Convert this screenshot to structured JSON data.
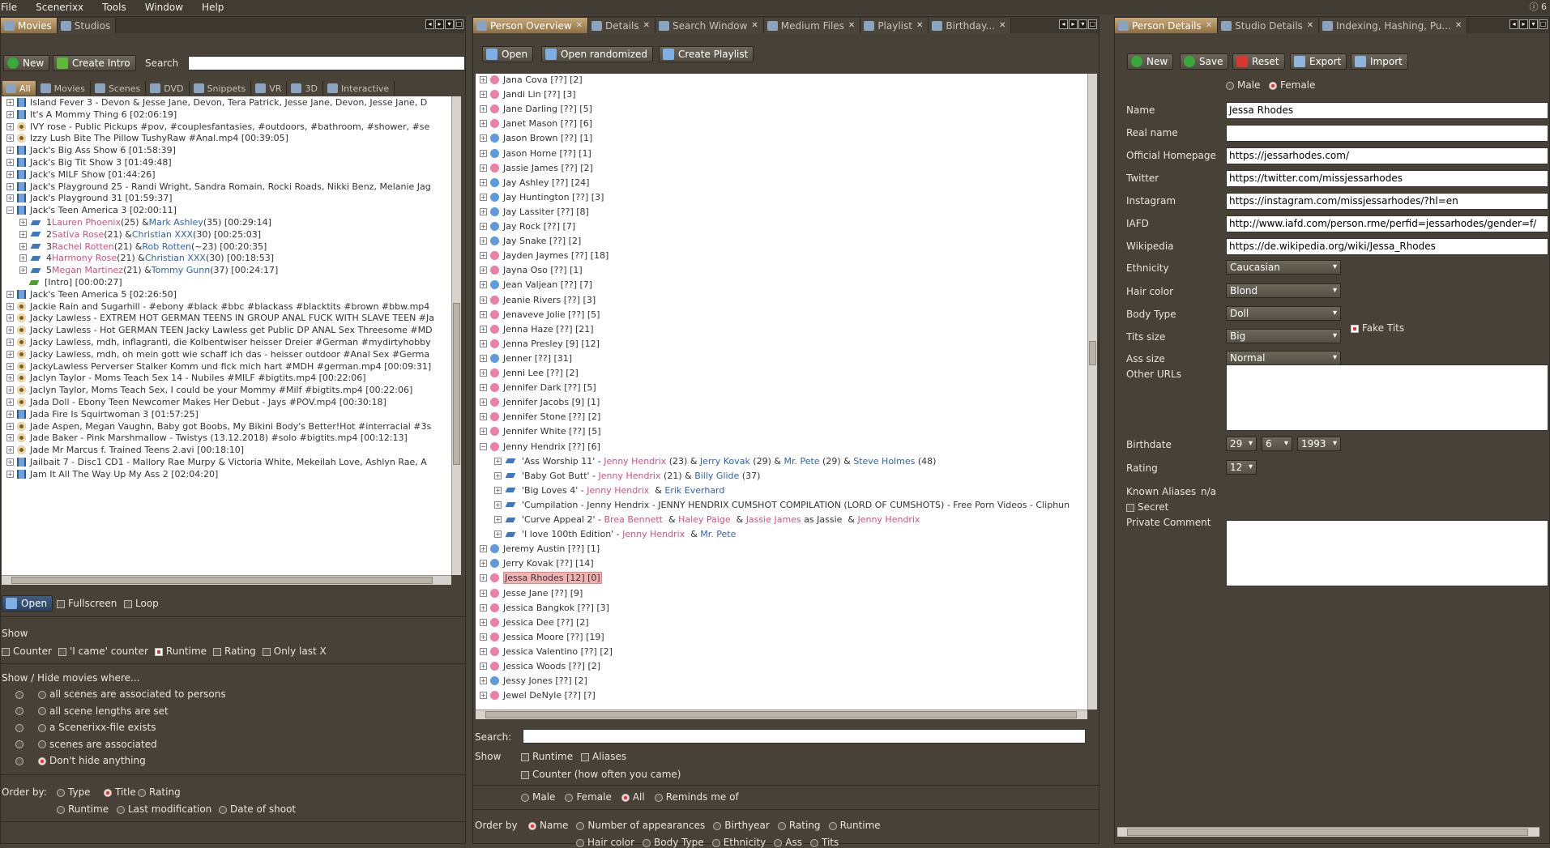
{
  "menu": {
    "items": [
      "File",
      "Scenerixx",
      "Tools",
      "Window",
      "Help"
    ],
    "right": "6"
  },
  "left": {
    "tabs": [
      "Movies",
      "Studios"
    ],
    "buttons": {
      "new": "New",
      "create_intro": "Create Intro"
    },
    "search_label": "Search",
    "filter_tabs": [
      "All",
      "Movies",
      "Scenes",
      "DVD",
      "Snippets",
      "VR",
      "3D",
      "Interactive"
    ],
    "movies": [
      {
        "t": "Island Fever 3 - Devon & Jesse Jane, Devon, Tera Patrick, Jesse Jane, Devon, Jesse Jane, D",
        "i": "film"
      },
      {
        "t": "It's A Mommy Thing 6 [02:06:19]",
        "i": "film"
      },
      {
        "t": "IVY rose - Public Pickups #pov, #couplesfantasies, #outdoors, #bathroom, #shower, #se",
        "i": "eye"
      },
      {
        "t": "Izzy Lush Bite The Pillow TushyRaw #Anal.mp4 [00:39:05]",
        "i": "eye"
      },
      {
        "t": "Jack's Big Ass Show 6 [01:58:39]",
        "i": "film"
      },
      {
        "t": "Jack's Big Tit Show 3 [01:49:48]",
        "i": "film"
      },
      {
        "t": "Jack's MILF Show [01:44:26]",
        "i": "film"
      },
      {
        "t": "Jack's Playground 25 - Randi Wright, Sandra Romain, Rocki Roads, Nikki Benz, Melanie Jag",
        "i": "film"
      },
      {
        "t": "Jack's Playground 31 [01:59:37]",
        "i": "film"
      },
      {
        "t": "Jack's Teen America 3 [02:00:11]",
        "i": "film",
        "open": true
      }
    ],
    "scenes": [
      {
        "n": "1",
        "p1": "Lauren Phoenix",
        "a1": "(25) &",
        "p2": "Mark Ashley",
        "a2": "(35) [00:29:14]"
      },
      {
        "n": "2",
        "p1": "Sativa Rose",
        "a1": "(21) &",
        "p2": "Christian XXX",
        "a2": "(30) [00:25:03]"
      },
      {
        "n": "3",
        "p1": "Rachel Rotten",
        "a1": "(21) &",
        "p2": "Rob Rotten",
        "a2": "(~23) [00:20:35]"
      },
      {
        "n": "4",
        "p1": "Harmony Rose",
        "a1": "(21) &",
        "p2": "Christian XXX",
        "a2": "(30) [00:18:53]"
      },
      {
        "n": "5",
        "p1": "Megan Martinez",
        "a1": "(21) &",
        "p2": "Tommy Gunn",
        "a2": "(37) [00:24:17]"
      }
    ],
    "intro": "[Intro]  [00:00:27]",
    "movies2": [
      {
        "t": "Jack's Teen America 5 [02:26:50]",
        "i": "film"
      },
      {
        "t": "Jackie Rain and Sugarhill - #ebony #black #bbc #blackass #blacktits #brown #bbw.mp4",
        "i": "eye"
      },
      {
        "t": "Jacky Lawless - EXTREM HOT GERMAN TEENS IN GROUP ANAL FUCK WITH SLAVE TEEN #Ja",
        "i": "eye"
      },
      {
        "t": "Jacky Lawless - Hot GERMAN TEEN Jacky Lawless get Public DP ANAL Sex Threesome #MD",
        "i": "eye"
      },
      {
        "t": "Jacky Lawless, mdh, inflagranti, die Kolbentwiser heisser Dreier #German #mydirtyhobby",
        "i": "eye"
      },
      {
        "t": "Jacky Lawless, mdh, oh mein gott wie schaff ich das - heisser outdoor #Anal Sex #Germa",
        "i": "eye"
      },
      {
        "t": "JackyLawless Perverser Stalker Komm und fick mich hart #MDH #german.mp4 [00:09:31]",
        "i": "eye"
      },
      {
        "t": "Jaclyn Taylor - Moms Teach Sex 14 - Nubiles #MILF #bigtits.mp4 [00:22:06]",
        "i": "eye"
      },
      {
        "t": "Jaclyn Taylor, Moms Teach Sex, I could be your Mommy #Milf #bigtits.mp4 [00:22:06]",
        "i": "eye"
      },
      {
        "t": "Jada Doll - Ebony Teen Newcomer Makes Her Debut - Jays #POV.mp4 [00:30:18]",
        "i": "eye"
      },
      {
        "t": "Jada Fire Is Squirtwoman 3 [01:57:25]",
        "i": "film"
      },
      {
        "t": "Jade Aspen, Megan Vaughn, Baby got Boobs, My Bikini Body's Better!Hot #interracial #3s",
        "i": "eye"
      },
      {
        "t": "Jade Baker - Pink Marshmallow - Twistys (13.12.2018) #solo #bigtits.mp4 [00:12:13]",
        "i": "eye"
      },
      {
        "t": "Jade Mr Marcus f. Trained Teens 2.avi [00:18:10]",
        "i": "eye"
      },
      {
        "t": "Jailbait 7 - Disc1 CD1 - Mallory Rae Murpy & Victoria White, Mekeilah Love, Ashlyn Rae, A",
        "i": "film"
      },
      {
        "t": "Jam It All The Way Up My Ass 2 [02:04:20]",
        "i": "film"
      }
    ],
    "open_btn": "Open",
    "fullscreen": "Fullscreen",
    "loop": "Loop",
    "show_label": "Show",
    "show_opts": [
      {
        "l": "Counter",
        "on": false
      },
      {
        "l": "'I came' counter",
        "on": false
      },
      {
        "l": "Runtime",
        "on": true
      },
      {
        "l": "Rating",
        "on": false
      },
      {
        "l": "Only last X",
        "on": false
      }
    ],
    "hide_label": "Show    / Hide movies where...",
    "hide_opts": [
      {
        "l": "all scenes are associated to persons",
        "on": false
      },
      {
        "l": "all scene lengths are set",
        "on": false
      },
      {
        "l": "a Scenerixx-file exists",
        "on": false
      },
      {
        "l": "scenes are associated",
        "on": false
      },
      {
        "l": "Don't hide anything",
        "on": true
      }
    ],
    "order_label": "Order by:",
    "order_opts": [
      {
        "l": "Type",
        "on": false
      },
      {
        "l": "Title",
        "on": true
      },
      {
        "l": "Rating",
        "on": false
      },
      {
        "l": "Runtime",
        "on": false
      },
      {
        "l": "Last modification",
        "on": false
      },
      {
        "l": "Date of shoot",
        "on": false
      }
    ]
  },
  "mid": {
    "tabs": [
      "Person Overview",
      "Details",
      "Search Window",
      "Medium Files",
      "Playlist",
      "Birthday..."
    ],
    "buttons": {
      "open": "Open",
      "open_rand": "Open randomized",
      "create_playlist": "Create Playlist"
    },
    "persons_a": [
      {
        "n": "Jana Cova [??] [2]",
        "g": "f"
      },
      {
        "n": "Jandi Lin [??] [3]",
        "g": "f"
      },
      {
        "n": "Jane Darling [??] [5]",
        "g": "f"
      },
      {
        "n": "Janet Mason [??] [6]",
        "g": "f"
      },
      {
        "n": "Jason Brown [??] [1]",
        "g": "m"
      },
      {
        "n": "Jason Horne [??] [1]",
        "g": "m"
      },
      {
        "n": "Jassie James [??] [2]",
        "g": "f"
      },
      {
        "n": "Jay Ashley [??] [24]",
        "g": "m"
      },
      {
        "n": "Jay Huntington [??] [3]",
        "g": "m"
      },
      {
        "n": "Jay Lassiter [??] [8]",
        "g": "m"
      },
      {
        "n": "Jay Rock [??] [7]",
        "g": "m"
      },
      {
        "n": "Jay Snake [??] [2]",
        "g": "m"
      },
      {
        "n": "Jayden Jaymes [??] [18]",
        "g": "f"
      },
      {
        "n": "Jayna Oso [??] [1]",
        "g": "f"
      },
      {
        "n": "Jean Valjean [??] [7]",
        "g": "m"
      },
      {
        "n": "Jeanie Rivers [??] [3]",
        "g": "f"
      },
      {
        "n": "Jenaveve Jolie [??] [5]",
        "g": "f"
      },
      {
        "n": "Jenna Haze [??] [21]",
        "g": "f"
      },
      {
        "n": "Jenna Presley [9] [12]",
        "g": "f"
      },
      {
        "n": "Jenner [??] [31]",
        "g": "m"
      },
      {
        "n": "Jenni Lee [??] [2]",
        "g": "f"
      },
      {
        "n": "Jennifer Dark [??] [5]",
        "g": "f"
      },
      {
        "n": "Jennifer Jacobs [9] [1]",
        "g": "f"
      },
      {
        "n": "Jennifer Stone [??] [2]",
        "g": "f"
      },
      {
        "n": "Jennifer White [??] [5]",
        "g": "f"
      },
      {
        "n": "Jenny Hendrix [??] [6]",
        "g": "f"
      }
    ],
    "jenny_scenes": [
      [
        {
          "t": "'Ass Worship 11' - ",
          "c": ""
        },
        {
          "t": "Jenny Hendrix",
          "c": "pink"
        },
        {
          "t": " (23) & ",
          "c": ""
        },
        {
          "t": "Jerry Kovak",
          "c": "blue"
        },
        {
          "t": " (29) & ",
          "c": ""
        },
        {
          "t": "Mr. Pete",
          "c": "blue"
        },
        {
          "t": " (29) & ",
          "c": ""
        },
        {
          "t": "Steve Holmes",
          "c": "blue"
        },
        {
          "t": " (48)",
          "c": ""
        }
      ],
      [
        {
          "t": "'Baby Got Butt' - ",
          "c": ""
        },
        {
          "t": "Jenny Hendrix",
          "c": "pink"
        },
        {
          "t": " (21) & ",
          "c": ""
        },
        {
          "t": "Billy Glide",
          "c": "blue"
        },
        {
          "t": " (37)",
          "c": ""
        }
      ],
      [
        {
          "t": "'Big Loves 4' - ",
          "c": ""
        },
        {
          "t": "Jenny Hendrix",
          "c": "pink"
        },
        {
          "t": "  & ",
          "c": ""
        },
        {
          "t": "Erik Everhard",
          "c": "blue"
        }
      ],
      [
        {
          "t": "'Cumpilation - Jenny Hendrix - JENNY HENDRIX CUMSHOT COMPILATION (LORD OF CUMSHOTS) - Free Porn Videos - Cliphun",
          "c": ""
        }
      ],
      [
        {
          "t": "'Curve Appeal 2' - ",
          "c": ""
        },
        {
          "t": "Brea Bennett",
          "c": "pink"
        },
        {
          "t": "  & ",
          "c": ""
        },
        {
          "t": "Haley Paige",
          "c": "pink"
        },
        {
          "t": "  & ",
          "c": ""
        },
        {
          "t": "Jassie James",
          "c": "pink"
        },
        {
          "t": " as Jassie  & ",
          "c": ""
        },
        {
          "t": "Jenny Hendrix",
          "c": "pink"
        }
      ],
      [
        {
          "t": "'I love 100th Edition' - ",
          "c": ""
        },
        {
          "t": "Jenny Hendrix",
          "c": "pink"
        },
        {
          "t": "  & ",
          "c": ""
        },
        {
          "t": "Mr. Pete",
          "c": "blue"
        }
      ]
    ],
    "persons_b": [
      {
        "n": "Jeremy Austin [??] [1]",
        "g": "m"
      },
      {
        "n": "Jerry Kovak [??] [14]",
        "g": "m"
      },
      {
        "n": "Jessa Rhodes [12] [0]",
        "g": "f",
        "sel": true
      },
      {
        "n": "Jesse Jane [??] [9]",
        "g": "f"
      },
      {
        "n": "Jessica Bangkok [??] [3]",
        "g": "f"
      },
      {
        "n": "Jessica Dee [??] [2]",
        "g": "f"
      },
      {
        "n": "Jessica Moore [??] [19]",
        "g": "f"
      },
      {
        "n": "Jessica Valentino [??] [2]",
        "g": "f"
      },
      {
        "n": "Jessica Woods [??] [2]",
        "g": "f"
      },
      {
        "n": "Jessy Jones [??] [2]",
        "g": "m"
      },
      {
        "n": "Jewel DeNyle [??] [?]",
        "g": "f"
      }
    ],
    "search_label": "Search:",
    "show_label": "Show",
    "runtime": "Runtime",
    "aliases": "Aliases",
    "counter": "Counter (how often you came)",
    "gender_opts": [
      {
        "l": "Male",
        "on": false
      },
      {
        "l": "Female",
        "on": false
      },
      {
        "l": "All",
        "on": true
      },
      {
        "l": "Reminds me of",
        "on": false
      }
    ],
    "order_label": "Order by",
    "order_row1": [
      {
        "l": "Name",
        "on": true
      },
      {
        "l": "Number of appearances",
        "on": false
      },
      {
        "l": "Birthyear",
        "on": false
      },
      {
        "l": "Rating",
        "on": false
      },
      {
        "l": "Runtime",
        "on": false
      }
    ],
    "order_row2": [
      {
        "l": "Hair color",
        "on": false
      },
      {
        "l": "Body Type",
        "on": false
      },
      {
        "l": "Ethnicity",
        "on": false
      },
      {
        "l": "Ass",
        "on": false
      },
      {
        "l": "Tits",
        "on": false
      }
    ]
  },
  "right": {
    "tabs": [
      "Person Details",
      "Studio Details",
      "Indexing, Hashing, Pu..."
    ],
    "buttons": {
      "new": "New",
      "save": "Save",
      "reset": "Reset",
      "export": "Export",
      "import": "Import"
    },
    "gender": {
      "male": "Male",
      "female": "Female"
    },
    "fields": [
      {
        "l": "Name",
        "v": "Jessa Rhodes"
      },
      {
        "l": "Real name",
        "v": ""
      },
      {
        "l": "Official Homepage",
        "v": "https://jessarhodes.com/"
      },
      {
        "l": "Twitter",
        "v": "https://twitter.com/missjessarhodes"
      },
      {
        "l": "Instagram",
        "v": "https://instagram.com/missjessarhodes/?hl=en"
      },
      {
        "l": "IAFD",
        "v": "http://www.iafd.com/person.rme/perfid=jessarhodes/gender=f/"
      },
      {
        "l": "Wikipedia",
        "v": "https://de.wikipedia.org/wiki/Jessa_Rhodes"
      }
    ],
    "selects": [
      {
        "l": "Ethnicity",
        "v": "Caucasian"
      },
      {
        "l": "Hair color",
        "v": "Blond"
      },
      {
        "l": "Body Type",
        "v": "Doll"
      },
      {
        "l": "Tits size",
        "v": "Big"
      },
      {
        "l": "Ass size",
        "v": "Normal"
      }
    ],
    "fake_tits": "Fake Tits",
    "other_urls": "Other URLs",
    "birthdate_label": "Birthdate",
    "bd_day": "29",
    "bd_month": "6",
    "bd_year": "1993",
    "rating_label": "Rating",
    "rating": "12",
    "aliases_label": "Known Aliases",
    "aliases_value": "n/a",
    "secret": "Secret",
    "private_comment": "Private Comment"
  }
}
